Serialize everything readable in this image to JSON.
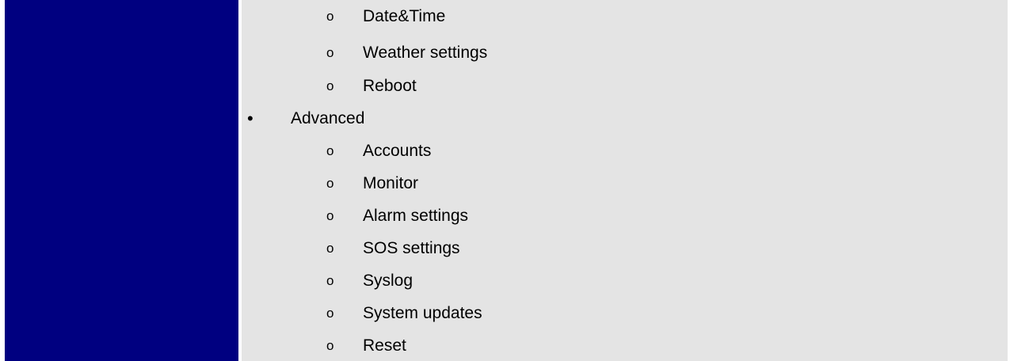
{
  "colors": {
    "left_cell": "#000080",
    "right_cell": "#e4e4e4",
    "text": "#000000"
  },
  "list": {
    "preceding_sub_items": [
      "Date&Time",
      "Weather settings",
      "Reboot"
    ],
    "section": {
      "marker": "•",
      "label": "Advanced",
      "sub_marker": "o",
      "items": [
        "Accounts",
        "Monitor",
        "Alarm settings",
        "SOS settings",
        "Syslog",
        "System updates",
        "Reset"
      ]
    }
  }
}
